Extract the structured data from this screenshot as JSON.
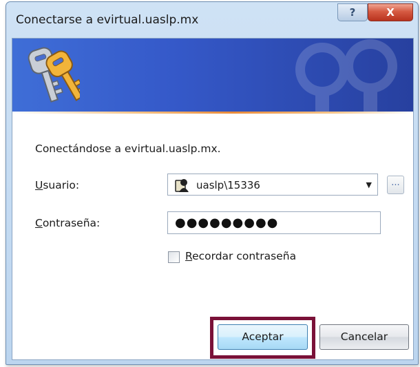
{
  "window": {
    "title": "Conectarse a evirtual.uaslp.mx",
    "help_label": "?",
    "close_label": "X"
  },
  "banner": {
    "icon": "keys-icon"
  },
  "message": "Conectándose a evirtual.uaslp.mx.",
  "form": {
    "user_label_mnemonic": "U",
    "user_label_rest": "suario:",
    "user_value": "uaslp\\15336",
    "user_icon": "user-card-icon",
    "browse_label": "...",
    "password_label_mnemonic": "C",
    "password_label_rest": "ontraseña:",
    "password_value": "●●●●●●●●●",
    "remember_mnemonic": "R",
    "remember_rest": "ecordar contraseña",
    "remember_checked": false
  },
  "buttons": {
    "ok": "Aceptar",
    "cancel": "Cancelar"
  },
  "colors": {
    "banner": "#3559c9",
    "highlight": "#7a1138",
    "close_button": "#c7432c"
  }
}
